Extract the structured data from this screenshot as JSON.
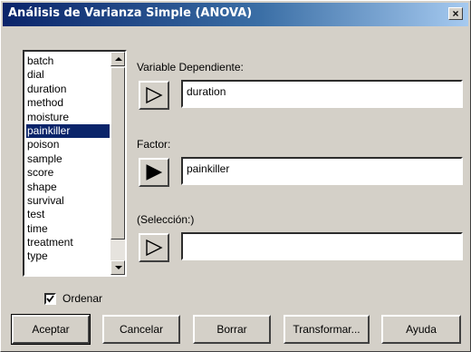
{
  "window": {
    "title": "Análisis de Varianza Simple (ANOVA)",
    "close_label": "×"
  },
  "variables": {
    "items": [
      "batch",
      "dial",
      "duration",
      "method",
      "moisture",
      "painkiller",
      "poison",
      "sample",
      "score",
      "shape",
      "survival",
      "test",
      "time",
      "treatment",
      "type"
    ],
    "selected": "painkiller"
  },
  "dependent": {
    "label": "Variable Dependiente:",
    "value": "duration",
    "arrow_icon": "arrow-right-hollow-icon"
  },
  "factor": {
    "label": "Factor:",
    "value": "painkiller",
    "arrow_icon": "arrow-right-filled-icon"
  },
  "selection": {
    "label": "(Selección:)",
    "value": "",
    "arrow_icon": "arrow-right-hollow-icon"
  },
  "order": {
    "label": "Ordenar",
    "checked": true
  },
  "buttons": {
    "accept": "Aceptar",
    "cancel": "Cancelar",
    "clear": "Borrar",
    "transform": "Transformar...",
    "help": "Ayuda"
  },
  "colors": {
    "selection": "#0a246a",
    "face": "#d4d0c8"
  }
}
